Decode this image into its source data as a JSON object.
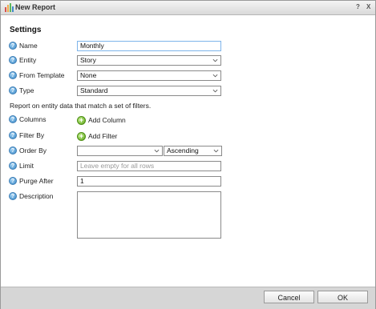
{
  "window": {
    "title": "New Report",
    "help_label": "?",
    "close_label": "X"
  },
  "settings": {
    "title": "Settings"
  },
  "fields": {
    "name": {
      "label": "Name",
      "value": "Monthly"
    },
    "entity": {
      "label": "Entity",
      "value": "Story"
    },
    "from_template": {
      "label": "From Template",
      "value": "None"
    },
    "type": {
      "label": "Type",
      "value": "Standard"
    },
    "columns": {
      "label": "Columns",
      "action": "Add Column"
    },
    "filter_by": {
      "label": "Filter By",
      "action": "Add Filter"
    },
    "order_by": {
      "label": "Order By",
      "value": "",
      "direction": "Ascending"
    },
    "limit": {
      "label": "Limit",
      "value": "",
      "placeholder": "Leave empty for all rows"
    },
    "purge_after": {
      "label": "Purge After",
      "value": "1"
    },
    "description": {
      "label": "Description",
      "value": ""
    }
  },
  "filters_note": "Report on entity data that match a set of filters.",
  "footer": {
    "cancel_label": "Cancel",
    "ok_label": "OK"
  },
  "colors": {
    "help_icon": "#3d8bc8",
    "add_icon": "#5aa317",
    "focus_border": "#7eb4ea"
  },
  "icons": {
    "title": "report-chart-icon",
    "help": "help-icon",
    "add": "add-icon",
    "dropdown": "chevron-down-icon"
  }
}
